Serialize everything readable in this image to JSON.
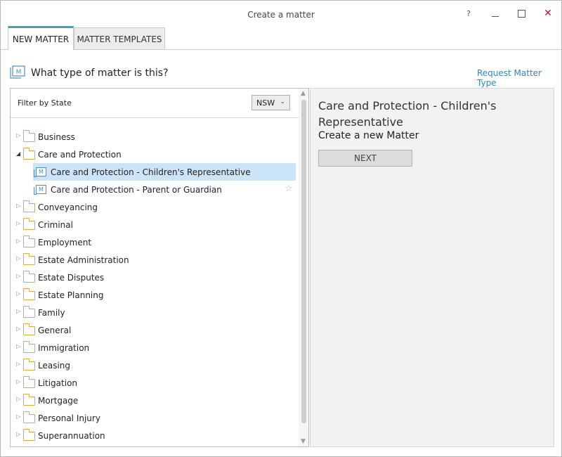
{
  "window": {
    "title": "Create a matter",
    "help_label": "?",
    "close_label": "✕"
  },
  "tabs": [
    {
      "label": "NEW MATTER",
      "active": true
    },
    {
      "label": "MATTER TEMPLATES",
      "active": false
    }
  ],
  "header": {
    "question": "What type of matter is this?",
    "request_link": "Request Matter Type"
  },
  "filter": {
    "label": "Filter by State",
    "selected_state": "NSW"
  },
  "tree": {
    "items": [
      {
        "label": "Business",
        "type": "folder",
        "expanded": false
      },
      {
        "label": "Care and Protection",
        "type": "folder",
        "expanded": true
      },
      {
        "label": "Care and Protection - Children's Representative",
        "type": "matter",
        "selected": true
      },
      {
        "label": "Care and Protection - Parent or Guardian",
        "type": "matter",
        "selected": false
      },
      {
        "label": "Conveyancing",
        "type": "folder",
        "expanded": false
      },
      {
        "label": "Criminal",
        "type": "folder",
        "expanded": false
      },
      {
        "label": "Employment",
        "type": "folder",
        "expanded": false
      },
      {
        "label": "Estate Administration",
        "type": "folder",
        "expanded": false
      },
      {
        "label": "Estate Disputes",
        "type": "folder",
        "expanded": false
      },
      {
        "label": "Estate Planning",
        "type": "folder",
        "expanded": false
      },
      {
        "label": "Family",
        "type": "folder",
        "expanded": false
      },
      {
        "label": "General",
        "type": "folder",
        "expanded": false
      },
      {
        "label": "Immigration",
        "type": "folder",
        "expanded": false
      },
      {
        "label": "Leasing",
        "type": "folder",
        "expanded": false
      },
      {
        "label": "Litigation",
        "type": "folder",
        "expanded": false
      },
      {
        "label": "Mortgage",
        "type": "folder",
        "expanded": false
      },
      {
        "label": "Personal Injury",
        "type": "folder",
        "expanded": false
      },
      {
        "label": "Superannuation",
        "type": "folder",
        "expanded": false
      }
    ]
  },
  "detail": {
    "title": "Care and Protection - Children's Representative",
    "subtitle": "Create a new Matter",
    "next_label": "NEXT"
  },
  "colors": {
    "accent": "#3a9ed8",
    "link": "#2a86c8",
    "selection": "#cce4f7",
    "folder": "#e7a92f",
    "close": "#c8102e"
  }
}
